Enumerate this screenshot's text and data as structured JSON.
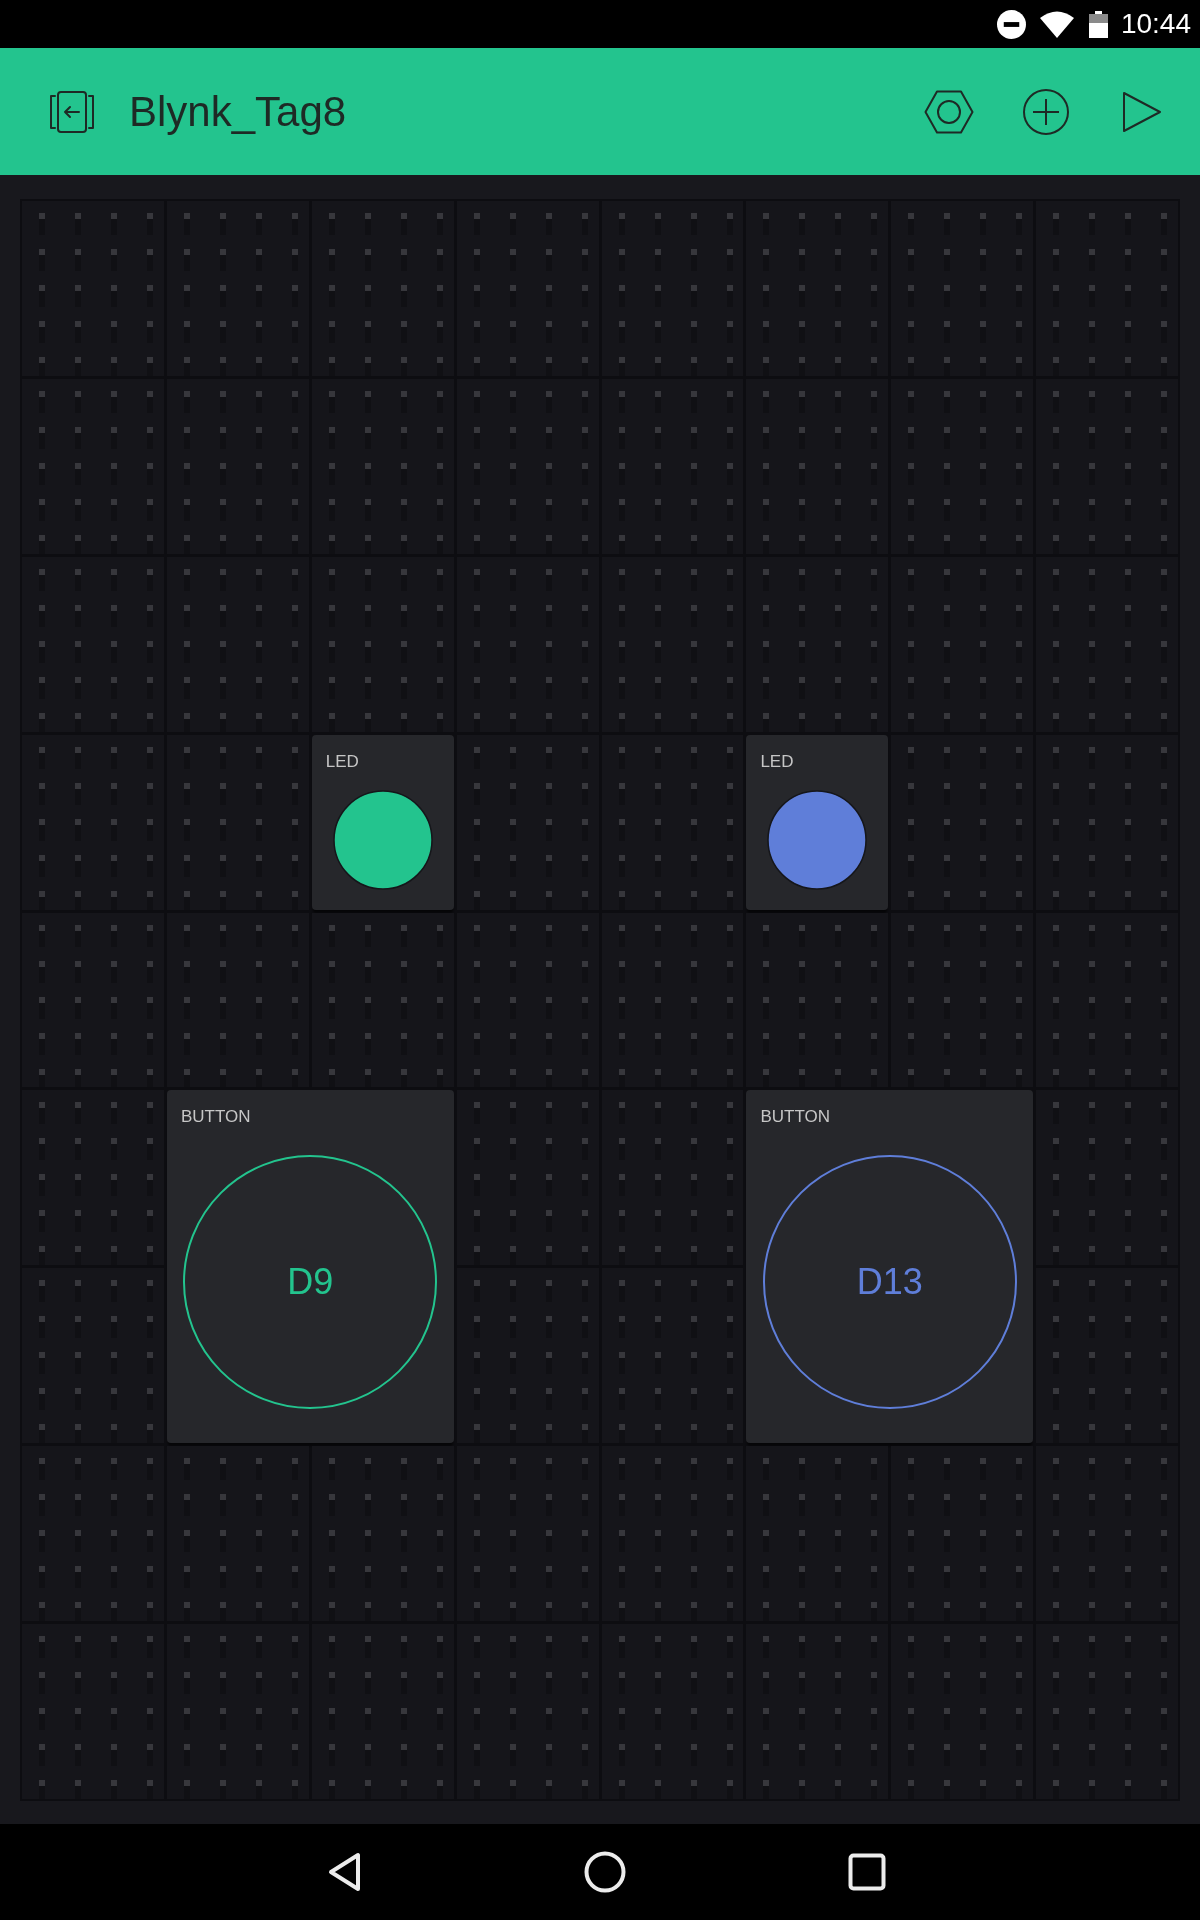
{
  "status_bar": {
    "time": "10:44"
  },
  "header": {
    "title": "Blynk_Tag8"
  },
  "widgets": [
    {
      "kind": "led",
      "label": "LED",
      "color": "#23c48e"
    },
    {
      "kind": "led",
      "label": "LED",
      "color": "#5f7ed9"
    },
    {
      "kind": "button",
      "label": "BUTTON",
      "pin": "D9",
      "on": false,
      "color": "#23c48e"
    },
    {
      "kind": "button",
      "label": "BUTTON",
      "pin": "D13",
      "on": false,
      "color": "#5f7ed9"
    }
  ]
}
